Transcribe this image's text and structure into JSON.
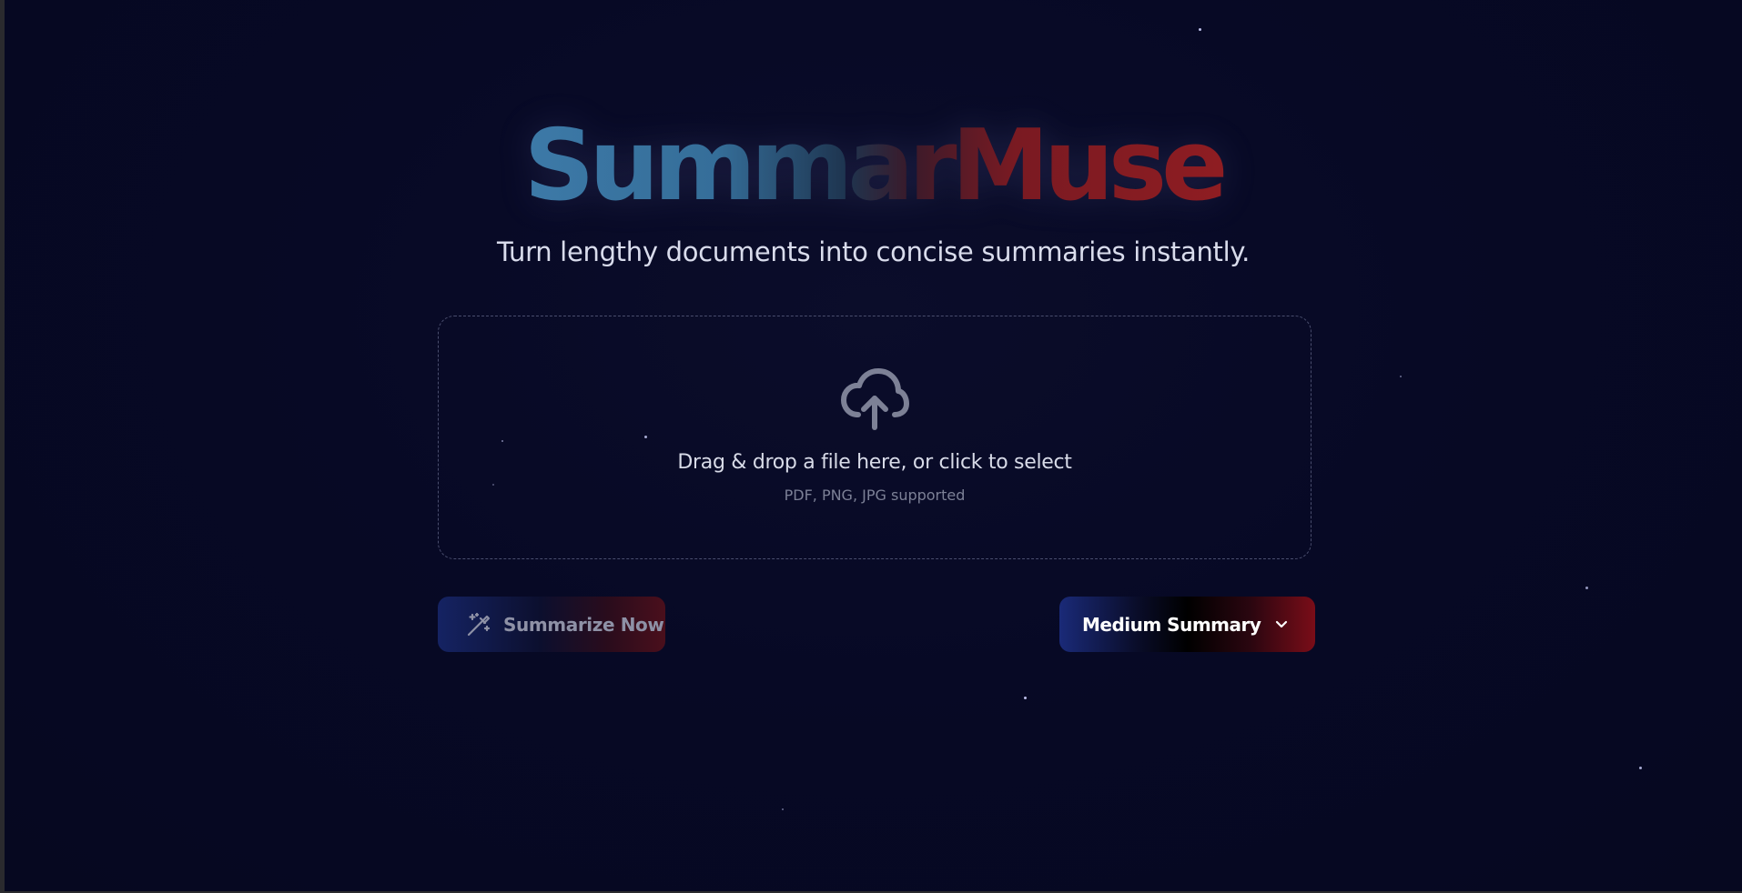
{
  "app": {
    "title": "SummarMuse",
    "tagline": "Turn lengthy documents into concise summaries instantly."
  },
  "upload": {
    "icon": "cloud-upload-icon",
    "prompt": "Drag & drop a file here, or click to select",
    "supported": "PDF, PNG, JPG supported"
  },
  "actions": {
    "summarize_icon": "magic-wand-icon",
    "summarize_label": "Summarize Now",
    "length_selected": "Medium Summary",
    "length_icon": "chevron-down-icon"
  },
  "colors": {
    "background": "#070925",
    "title_blue": "#3d7aa8",
    "title_red": "#8f1d22",
    "accent_blue": "#1a2a78",
    "accent_red": "#7a0d18"
  }
}
